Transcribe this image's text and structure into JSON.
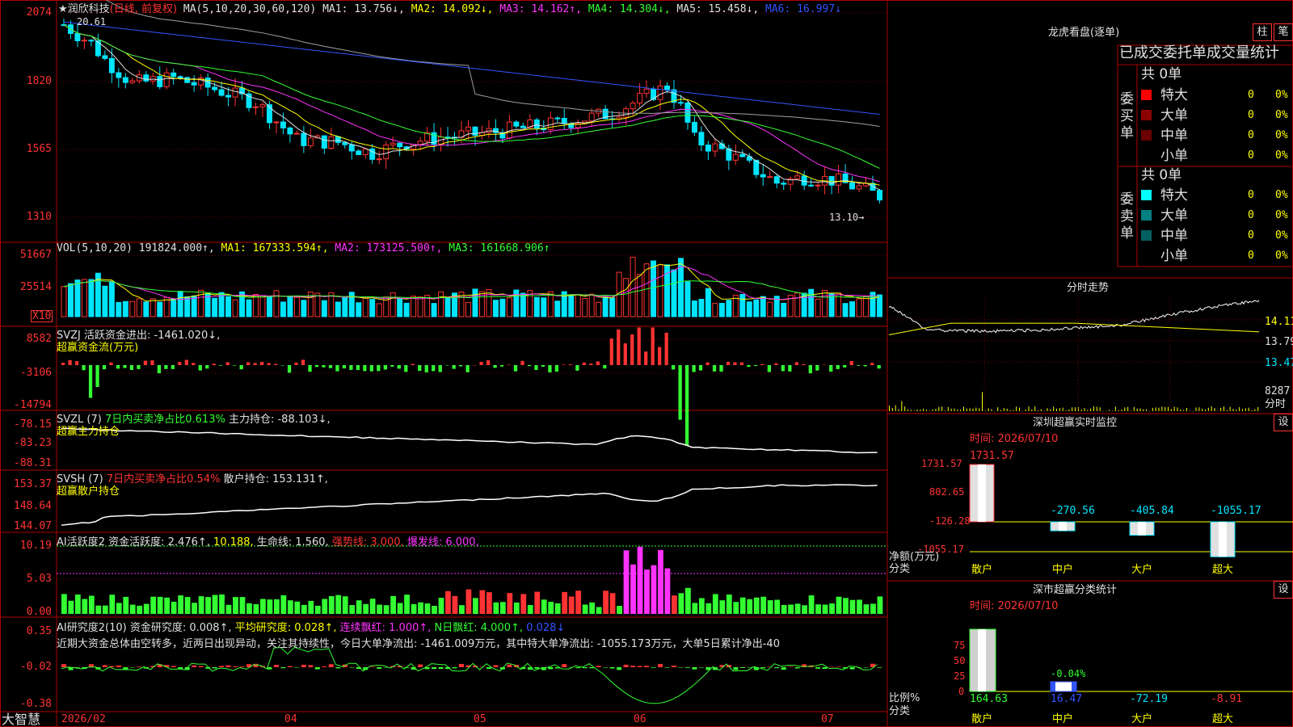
{
  "colors": {
    "up": "#ff3333",
    "down": "#00e5ff",
    "ma1": "#e0e0e0",
    "ma2": "#ffff00",
    "ma3": "#ff33ff",
    "ma4": "#33ff33",
    "ma5": "#a0a0a0",
    "ma6": "#3355ff",
    "grid": "#b00000"
  },
  "main": {
    "title": "★润欣科技",
    "mode": "(日线, 前复权)",
    "ma_label": "MA(5,10,20,30,60,120)",
    "ma1": "MA1: 13.756↓,",
    "ma2": "MA2: 14.092↓,",
    "ma3": "MA3: 14.162↑,",
    "ma4": "MA4: 14.304↓,",
    "ma5": "MA5: 15.458↓,",
    "ma6": "MA6: 16.997↓",
    "high_mark": "20.61",
    "low_mark": "13.10→",
    "axis": [
      "2074",
      "1820",
      "1565",
      "1310"
    ]
  },
  "vol": {
    "label": "VOL(5,10,20)",
    "value": "191824.000↑,",
    "ma1": "MA1: 167333.594↑,",
    "ma2": "MA2: 173125.500↑,",
    "ma3": "MA3: 161668.906↑",
    "axis": [
      "51667",
      "25514"
    ],
    "unit": "X10"
  },
  "svzj": {
    "label": "SVZJ  活跃资金进出: -1461.020↓,",
    "sub": "超赢资金流(万元)",
    "axis": [
      "8582",
      "-3106",
      "-14794"
    ]
  },
  "svzl": {
    "label": "SVZL (7)",
    "ratio": "7日内买卖净占比0.613%",
    "hold": "主力持仓: -88.103↓,",
    "sub": "超赢主力持仓",
    "axis": [
      "-78.15",
      "-83.23",
      "-88.31"
    ]
  },
  "svsh": {
    "label": "SVSH (7)",
    "ratio": "7日内买卖净占比0.54%",
    "hold": "散户持仓: 153.131↑,",
    "sub": "超赢散户持仓",
    "axis": [
      "153.37",
      "148.64",
      "144.07"
    ]
  },
  "ai1": {
    "label": "AI活跃度2",
    "active": "资金活跃度: 2.476↑,",
    "v2": "10.188,",
    "life": "生命线: 1.560,",
    "strong": "强势线: 3.000,",
    "burst": "爆发线: 6.000,",
    "axis": [
      "10.19",
      "5.03",
      "0.00"
    ]
  },
  "ai2": {
    "label": "AI研究度2(10)",
    "research": "资金研究度: 0.008↑,",
    "avg": "平均研究度: 0.028↑,",
    "cont": "连续飘红: 1.000↑,",
    "nred": "N日飘红: 4.000↑,",
    "last": "0.028↓",
    "comment": "近期大资金总体由空转多，近两日出现异动，关注其持续性，今日大单净流出: -1461.009万元，其中特大单净流出: -1055.173万元，大单5日累计净出-40",
    "axis": [
      "0.35",
      "-0.02",
      "-0.38"
    ]
  },
  "xaxis": {
    "app": "大智慧",
    "labels": [
      "2026/02",
      "04",
      "05",
      "06",
      "07"
    ]
  },
  "right": {
    "lhkp": "龙虎看盘(逐单)",
    "btn_zhu": "柱",
    "btn_bi": "笔",
    "table_title": "已成交委托单成交量统计",
    "buy_label": "委买单",
    "sell_label": "委卖单",
    "buy_total": "共 0单",
    "sell_total": "共 0单",
    "buy_rows": [
      {
        "name": "特大",
        "qty": "0",
        "pct": "0%",
        "color": "#ff0000"
      },
      {
        "name": "大单",
        "qty": "0",
        "pct": "0%",
        "color": "#8b0000"
      },
      {
        "name": "中单",
        "qty": "0",
        "pct": "0%",
        "color": "#6b0000"
      },
      {
        "name": "小单",
        "qty": "0",
        "pct": "0%",
        "color": ""
      }
    ],
    "sell_rows": [
      {
        "name": "特大",
        "qty": "0",
        "pct": "0%",
        "color": "#00ffff"
      },
      {
        "name": "大单",
        "qty": "0",
        "pct": "0%",
        "color": "#008080"
      },
      {
        "name": "中单",
        "qty": "0",
        "pct": "0%",
        "color": "#006060"
      },
      {
        "name": "小单",
        "qty": "0",
        "pct": "0%",
        "color": ""
      }
    ],
    "intraday_title": "分时走势",
    "intraday_axis": [
      "14.11",
      "13.79",
      "13.47"
    ],
    "intraday_vol": "8287",
    "intraday_vol_unit": "分时",
    "monitor_title": "深圳超赢实时监控",
    "monitor_btn": "设",
    "monitor_time": "时间: 2026/07/10",
    "monitor_axis": [
      "1731.57",
      "802.65",
      "-126.28",
      "-1055.17"
    ],
    "monitor_ylabel": "净额(万元)",
    "monitor_xlabel": "分类",
    "monitor_bars": [
      {
        "name": "散户",
        "value": 1731.57,
        "label": "1731.57"
      },
      {
        "name": "中户",
        "value": -270.56,
        "label": "-270.56"
      },
      {
        "name": "大户",
        "value": -405.84,
        "label": "-405.84"
      },
      {
        "name": "超大",
        "value": -1055.17,
        "label": "-1055.17"
      }
    ],
    "stat_title": "深市超赢分类统计",
    "stat_btn": "设",
    "stat_time": "时间: 2026/07/10",
    "stat_axis": [
      "75",
      "50",
      "25",
      "0"
    ],
    "stat_ylabel": "比例%",
    "stat_xlabel": "分类",
    "stat_note": "-0.04%",
    "stat_values": [
      "164.63",
      "16.47",
      "-72.19",
      "-8.91"
    ],
    "stat_names": [
      "散户",
      "中户",
      "大户",
      "超大"
    ]
  }
}
